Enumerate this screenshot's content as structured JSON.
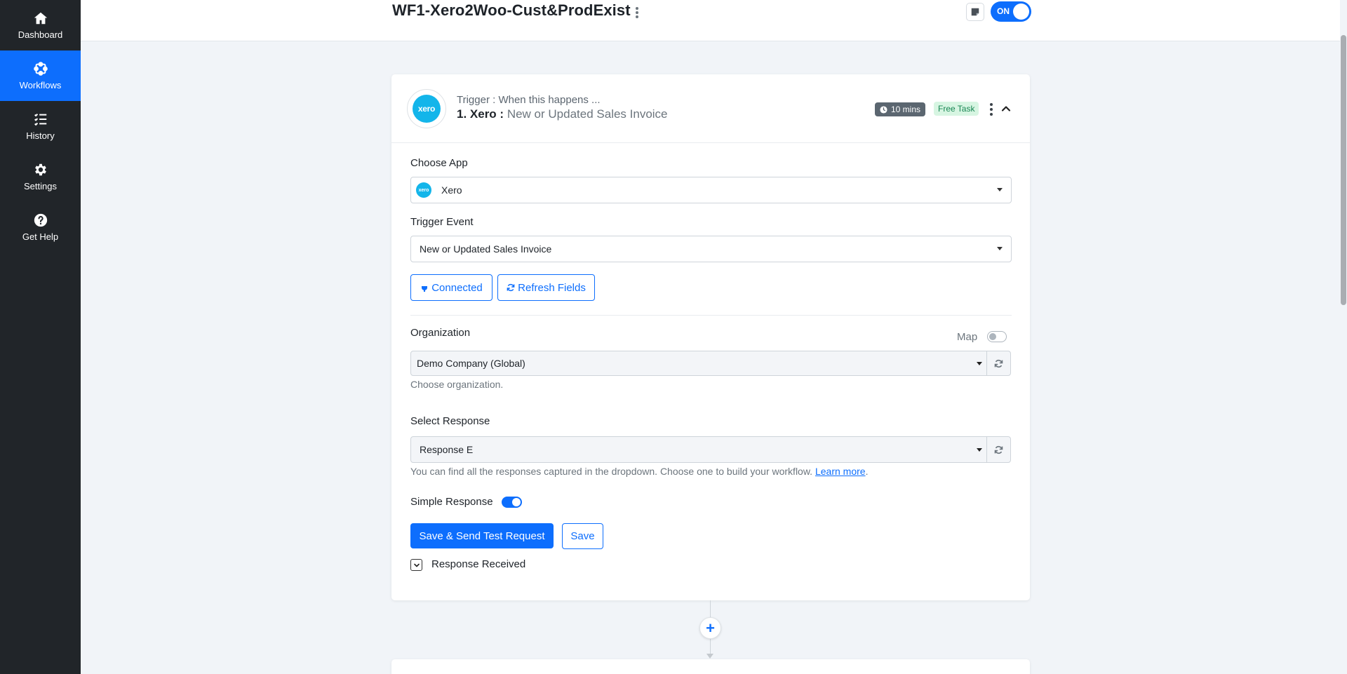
{
  "sidebar": {
    "items": [
      {
        "label": "Dashboard",
        "icon": "home-icon"
      },
      {
        "label": "Workflows",
        "icon": "workflow-icon"
      },
      {
        "label": "History",
        "icon": "list-check-icon"
      },
      {
        "label": "Settings",
        "icon": "gear-icon"
      },
      {
        "label": "Get Help",
        "icon": "question-circle-icon"
      }
    ]
  },
  "header": {
    "title": "WF1-Xero2Woo-Cust&ProdExist",
    "toggle_label": "ON"
  },
  "trigger": {
    "subtitle": "Trigger : When this happens ...",
    "number_app": "1. Xero :",
    "event_name": "New or Updated Sales Invoice",
    "logo_text": "xero",
    "time_badge": "10 mins",
    "task_badge": "Free Task"
  },
  "form": {
    "choose_app_label": "Choose App",
    "app_value": "Xero",
    "app_logo_text": "xero",
    "trigger_event_label": "Trigger Event",
    "trigger_event_value": "New or Updated Sales Invoice",
    "connected_label": "Connected",
    "refresh_fields_label": "Refresh Fields",
    "organization_label": "Organization",
    "map_label": "Map",
    "organization_value": "Demo Company (Global)",
    "organization_help": "Choose organization.",
    "select_response_label": "Select Response",
    "response_value": "Response E",
    "response_help": "You can find all the responses captured in the dropdown. Choose one to build your workflow.",
    "learn_more": "Learn more",
    "help_period": ".",
    "simple_response_label": "Simple Response",
    "save_send_label": "Save & Send Test Request",
    "save_label": "Save",
    "response_received_label": "Response Received"
  },
  "connector": {
    "add_symbol": "+"
  },
  "colors": {
    "sidebar_bg": "#212529",
    "accent": "#0d6efd",
    "xero_brand": "#13b5ea",
    "page_bg": "#f1f4f8"
  }
}
